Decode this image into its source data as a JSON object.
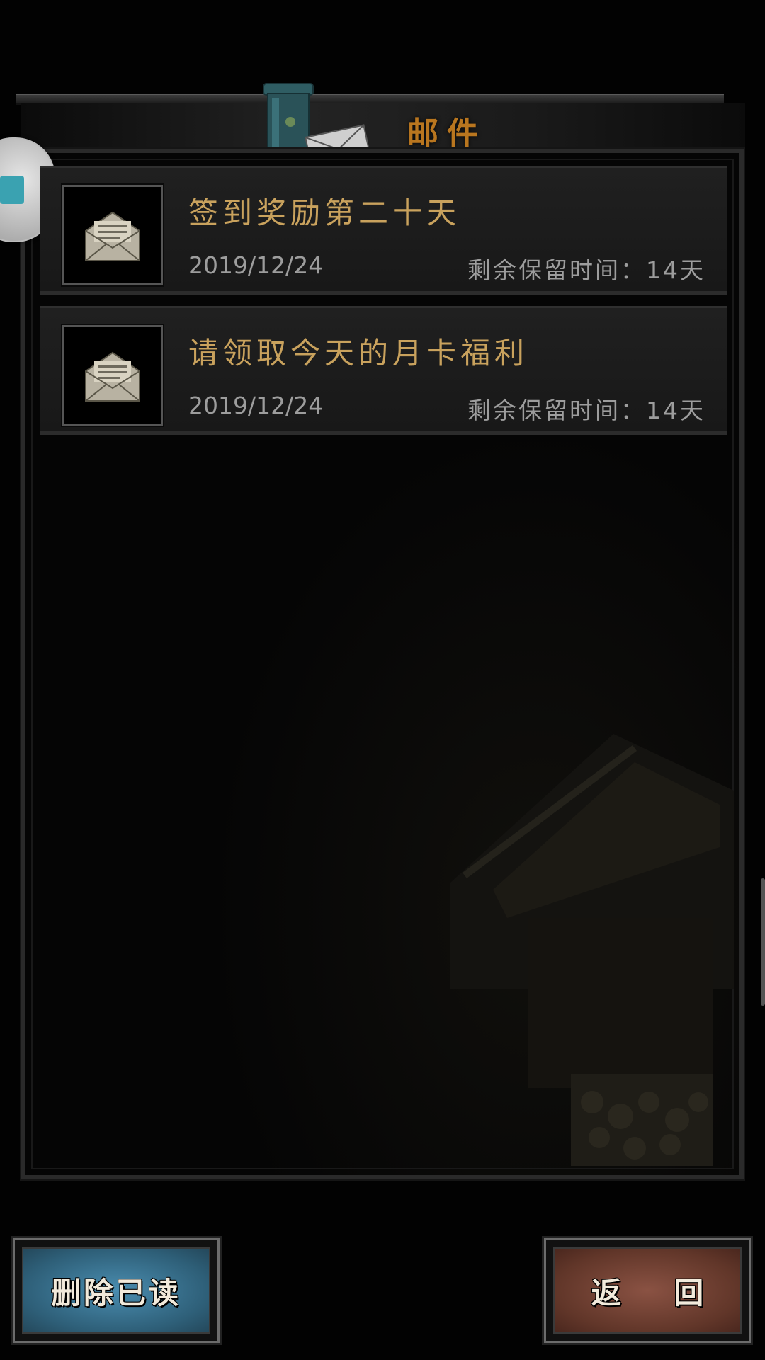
{
  "header": {
    "title": "邮件",
    "mailbox_icon": "mailbox-icon"
  },
  "floating_bubble": {
    "icon": "assistant-bubble-icon"
  },
  "mails": [
    {
      "title": "签到奖励第二十天",
      "date": "2019/12/24",
      "retention": "剩余保留时间：14天",
      "icon": "open-envelope-icon"
    },
    {
      "title": "请领取今天的月卡福利",
      "date": "2019/12/24",
      "retention": "剩余保留时间：14天",
      "icon": "open-envelope-icon"
    }
  ],
  "buttons": {
    "delete_read": "删除已读",
    "back": "返 回"
  },
  "colors": {
    "title_orange": "#b9761f",
    "mail_title_gold": "#c9a25d",
    "meta_gray": "#9d9d9d",
    "delete_button_blue": "#3a7896",
    "back_button_red": "#7a4536"
  }
}
